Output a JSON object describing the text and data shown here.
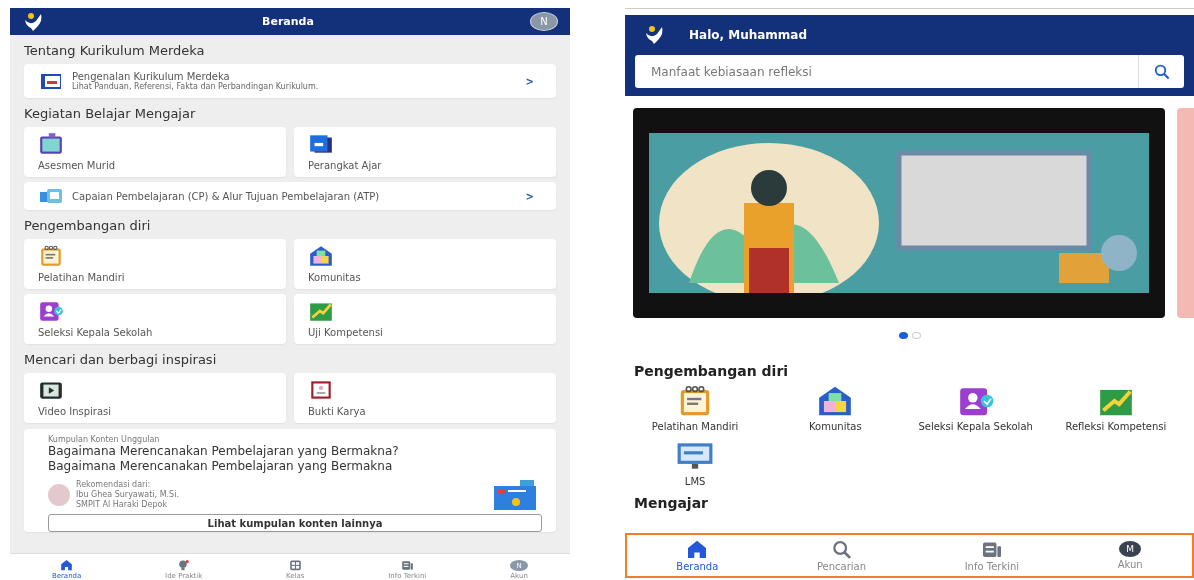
{
  "left_screen": {
    "header": {
      "title": "Beranda",
      "avatar": "N"
    },
    "sections": [
      {
        "title": "Tentang Kurikulum Merdeka",
        "items": [
          {
            "kind": "wide",
            "label": "Pengenalan Kurikulum Merdeka",
            "subtitle": "Lihat Panduan, Referensi, Fakta dan Perbandingan Kurikulum.",
            "chevron": ">"
          }
        ]
      },
      {
        "title": "Kegiatan Belajar Mengajar",
        "items": [
          {
            "kind": "tile",
            "label": "Asesmen Murid"
          },
          {
            "kind": "tile",
            "label": "Perangkat Ajar"
          },
          {
            "kind": "wide",
            "label": "Capaian Pembelajaran (CP) & Alur Tujuan Pembelajaran (ATP)",
            "chevron": ">"
          }
        ]
      },
      {
        "title": "Pengembangan diri",
        "items": [
          {
            "kind": "tile",
            "label": "Pelatihan Mandiri"
          },
          {
            "kind": "tile",
            "label": "Komunitas"
          },
          {
            "kind": "tile",
            "label": "Seleksi Kepala Sekolah"
          },
          {
            "kind": "tile",
            "label": "Uji Kompetensi"
          }
        ]
      },
      {
        "title": "Mencari dan berbagi inspirasi",
        "items": [
          {
            "kind": "tile",
            "label": "Video Inspirasi"
          },
          {
            "kind": "tile",
            "label": "Bukti Karya"
          }
        ]
      }
    ],
    "featured": {
      "label": "Kumpulan Konten Unggulan",
      "title_lines": [
        "Bagaimana Merencanakan Pembelajaran yang Bermakna?",
        "Bagaimana Merencanakan Pembelajaran yang Bermakna"
      ],
      "recommended_by": "Rekomendasi dari:",
      "author": "Ibu Ghea Suryawati, M.Si.",
      "school": "SMPIT Al Haraki Depok",
      "button": "Lihat kumpulan konten lainnya"
    },
    "bottom_nav": [
      {
        "label": "Beranda",
        "selected": true
      },
      {
        "label": "Ide Praktik",
        "selected": false
      },
      {
        "label": "Kelas",
        "selected": false
      },
      {
        "label": "Info Terkini",
        "selected": false
      },
      {
        "label": "Akun",
        "selected": false,
        "avatar": "N"
      }
    ]
  },
  "right_screen": {
    "header": {
      "greeting": "Halo, Muhammad"
    },
    "search": {
      "placeholder": "Manfaat kebiasaan refleksi"
    },
    "carousel_dots": [
      {
        "selected": true
      },
      {
        "selected": false
      }
    ],
    "sections": [
      {
        "title": "Pengembangan diri",
        "items": [
          {
            "label": "Pelatihan Mandiri"
          },
          {
            "label": "Komunitas"
          },
          {
            "label": "Seleksi Kepala Sekolah"
          },
          {
            "label": "Refleksi Kompetensi"
          },
          {
            "label": "LMS"
          }
        ]
      },
      {
        "title": "Mengajar"
      }
    ],
    "bottom_nav": [
      {
        "label": "Beranda",
        "selected": true
      },
      {
        "label": "Pencarian",
        "selected": false
      },
      {
        "label": "Info Terkini",
        "selected": false
      },
      {
        "label": "Akun",
        "selected": false,
        "avatar": "M"
      }
    ]
  }
}
